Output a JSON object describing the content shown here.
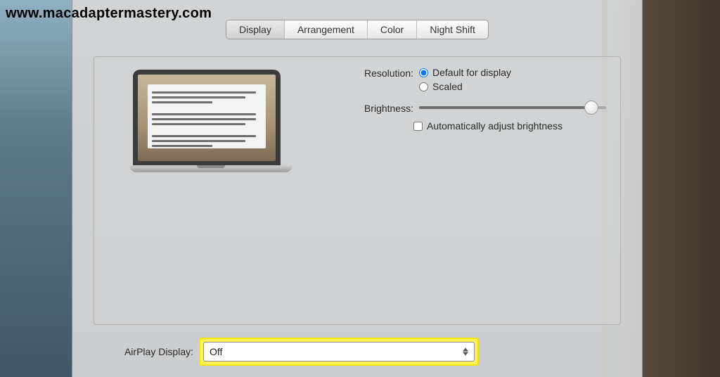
{
  "watermark": "www.macadaptermastery.com",
  "tabs": {
    "items": [
      "Display",
      "Arrangement",
      "Color",
      "Night Shift"
    ],
    "activeIndex": 0
  },
  "settings": {
    "resolution": {
      "label": "Resolution:",
      "options": {
        "default": "Default for display",
        "scaled": "Scaled"
      },
      "selected": "default"
    },
    "brightness": {
      "label": "Brightness:",
      "autoLabel": "Automatically adjust brightness",
      "autoChecked": false,
      "value": 0.92
    }
  },
  "airplay": {
    "label": "AirPlay Display:",
    "value": "Off"
  }
}
